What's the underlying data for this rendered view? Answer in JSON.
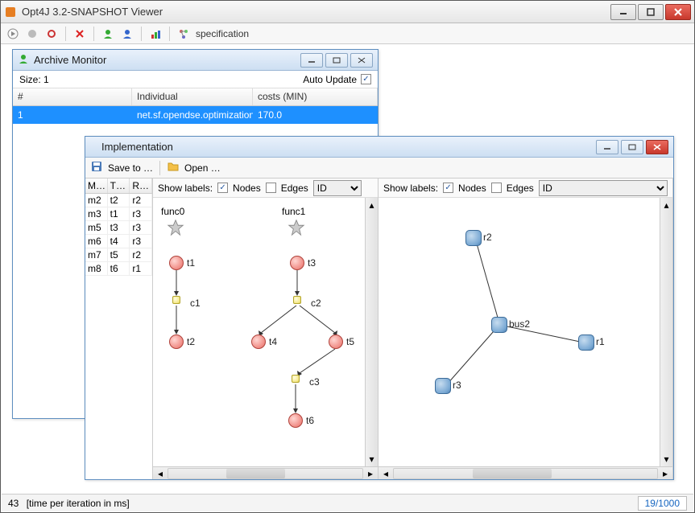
{
  "app": {
    "title": "Opt4J 3.2-SNAPSHOT Viewer"
  },
  "toolbar": {
    "spec_label": "specification"
  },
  "archive": {
    "title": "Archive Monitor",
    "size_label": "Size: 1",
    "auto_label": "Auto Update",
    "cols": {
      "idx": "#",
      "ind": "Individual",
      "cost": "costs (MIN)"
    },
    "row": {
      "idx": "1",
      "ind": "net.sf.opendse.optimization…",
      "cost": "170.0"
    }
  },
  "impl": {
    "title": "Implementation",
    "save_label": "Save to …",
    "open_label": "Open …",
    "map_cols": {
      "m": "M…",
      "t": "T…",
      "r": "R…"
    },
    "map_rows": [
      {
        "m": "m2",
        "t": "t2",
        "r": "r2"
      },
      {
        "m": "m3",
        "t": "t1",
        "r": "r3"
      },
      {
        "m": "m5",
        "t": "t3",
        "r": "r3"
      },
      {
        "m": "m6",
        "t": "t4",
        "r": "r3"
      },
      {
        "m": "m7",
        "t": "t5",
        "r": "r2"
      },
      {
        "m": "m8",
        "t": "t6",
        "r": "r1"
      }
    ],
    "show_labels": "Show labels:",
    "nodes_lbl": "Nodes",
    "edges_lbl": "Edges",
    "id_lbl": "ID",
    "left_graph": {
      "funcs": [
        "func0",
        "func1"
      ],
      "tasks": [
        "t1",
        "t2",
        "t3",
        "t4",
        "t5",
        "t6"
      ],
      "comms": [
        "c1",
        "c2",
        "c3"
      ]
    },
    "right_graph": {
      "nodes": [
        "r1",
        "r2",
        "r3",
        "bus2"
      ]
    }
  },
  "status": {
    "left_num": "43",
    "left_txt": "[time per iteration in ms]",
    "right": "19/1000"
  }
}
